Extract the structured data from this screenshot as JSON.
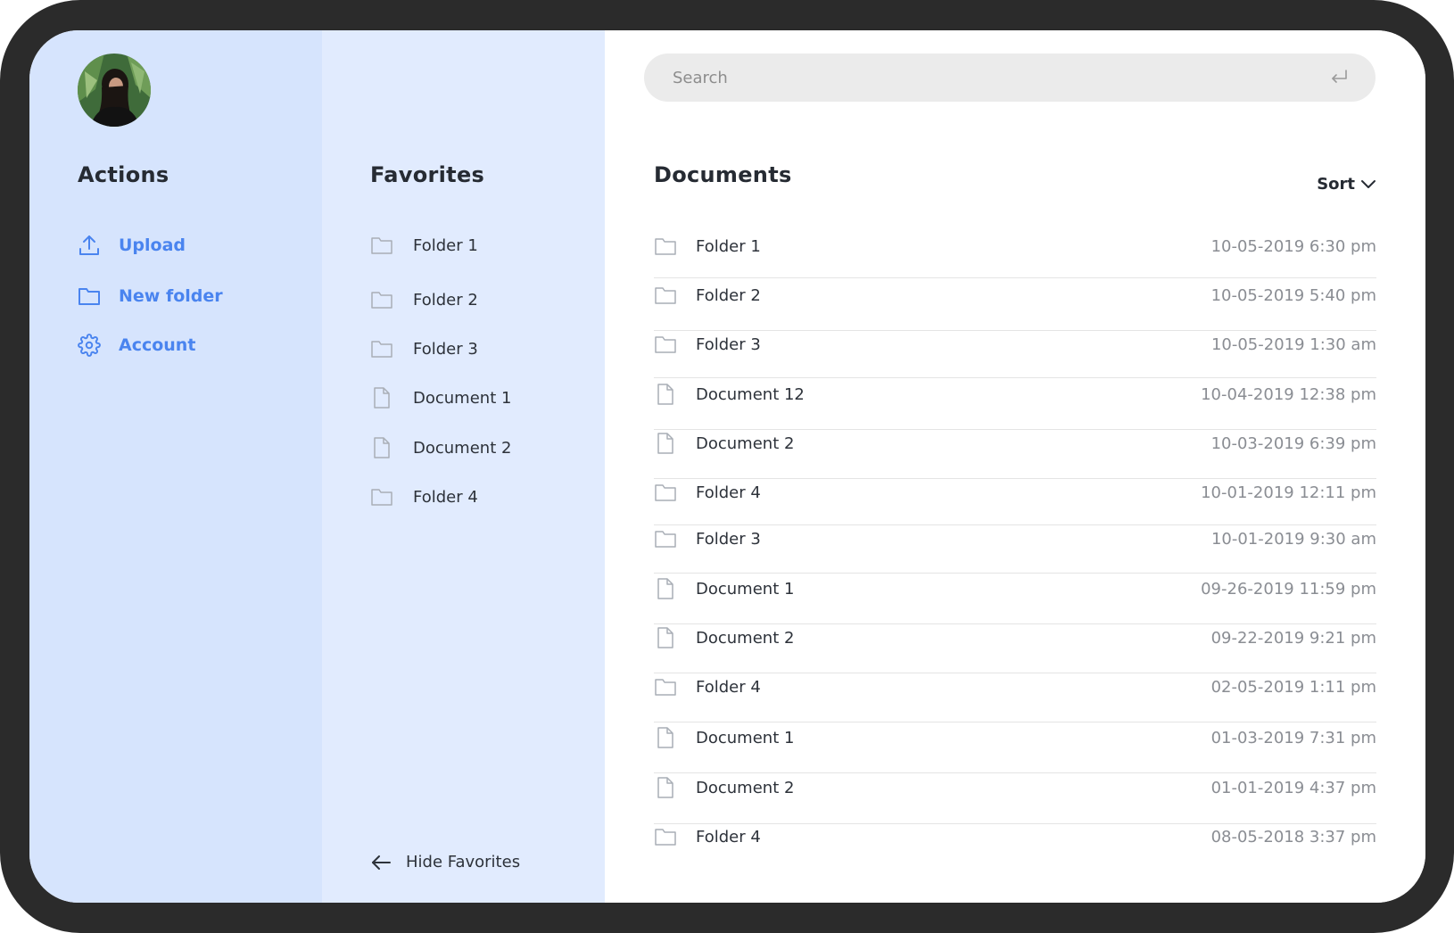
{
  "actions": {
    "title": "Actions",
    "items": [
      {
        "label": "Upload",
        "icon": "upload-icon"
      },
      {
        "label": "New folder",
        "icon": "folder-icon"
      },
      {
        "label": "Account",
        "icon": "gear-icon"
      }
    ]
  },
  "favorites": {
    "title": "Favorites",
    "items": [
      {
        "label": "Folder 1",
        "icon": "folder-icon"
      },
      {
        "label": "Folder 2",
        "icon": "folder-icon"
      },
      {
        "label": "Folder 3",
        "icon": "folder-icon"
      },
      {
        "label": "Document 1",
        "icon": "document-icon"
      },
      {
        "label": "Document 2",
        "icon": "document-icon"
      },
      {
        "label": "Folder 4",
        "icon": "folder-icon"
      }
    ],
    "hide_label": "Hide Favorites"
  },
  "search": {
    "placeholder": "Search"
  },
  "documents": {
    "title": "Documents",
    "sort_label": "Sort",
    "rows": [
      {
        "name": "Folder 1",
        "date": "10-05-2019 6:30 pm",
        "icon": "folder-icon"
      },
      {
        "name": "Folder 2",
        "date": "10-05-2019 5:40 pm",
        "icon": "folder-icon"
      },
      {
        "name": "Folder 3",
        "date": "10-05-2019 1:30 am",
        "icon": "folder-icon"
      },
      {
        "name": "Document 12",
        "date": "10-04-2019 12:38 pm",
        "icon": "document-icon"
      },
      {
        "name": "Document 2",
        "date": "10-03-2019 6:39 pm",
        "icon": "document-icon"
      },
      {
        "name": "Folder 4",
        "date": "10-01-2019 12:11 pm",
        "icon": "folder-icon"
      },
      {
        "name": "Folder 3",
        "date": "10-01-2019 9:30 am",
        "icon": "folder-icon"
      },
      {
        "name": "Document 1",
        "date": "09-26-2019 11:59 pm",
        "icon": "document-icon"
      },
      {
        "name": "Document 2",
        "date": "09-22-2019 9:21 pm",
        "icon": "document-icon"
      },
      {
        "name": "Folder 4",
        "date": "02-05-2019 1:11 pm",
        "icon": "folder-icon"
      },
      {
        "name": "Document 1",
        "date": "01-03-2019 7:31 pm",
        "icon": "document-icon"
      },
      {
        "name": "Document 2",
        "date": "01-01-2019 4:37 pm",
        "icon": "document-icon"
      },
      {
        "name": "Folder 4",
        "date": "08-05-2018 3:37 pm",
        "icon": "folder-icon"
      }
    ]
  },
  "colors": {
    "accent": "#4a84ef",
    "actions_bg": "#d6e4fd",
    "favorites_bg": "#e1ebfe",
    "frame": "#2b2b2b"
  }
}
